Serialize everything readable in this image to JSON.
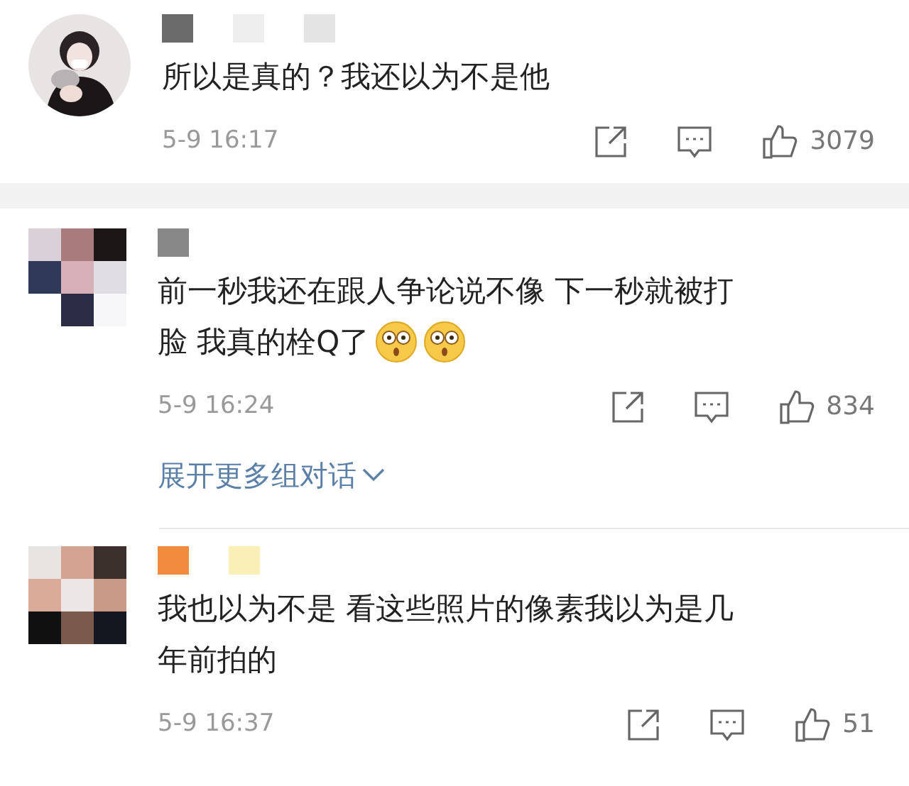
{
  "comments": [
    {
      "avatar": {
        "kind": "picture"
      },
      "text_lines": [
        "所以是真的？我还以为不是他"
      ],
      "time": "5-9 16:17",
      "likes": "3079"
    },
    {
      "avatar": {
        "kind": "mosaic"
      },
      "text_lines": [
        "前一秒我还在跟人争论说不像 下一秒就被打",
        "脸 我真的栓Q了"
      ],
      "reactions": [
        {
          "kind": "astonished"
        },
        {
          "kind": "astonished"
        }
      ],
      "time": "5-9 16:24",
      "likes": "834",
      "expand_link": "展开更多组对话"
    },
    {
      "avatar": {
        "kind": "mosaic"
      },
      "text_lines": [
        "我也以为不是 看这些照片的像素我以为是几",
        "年前拍的"
      ],
      "time": "5-9 16:37",
      "likes": "51"
    }
  ]
}
